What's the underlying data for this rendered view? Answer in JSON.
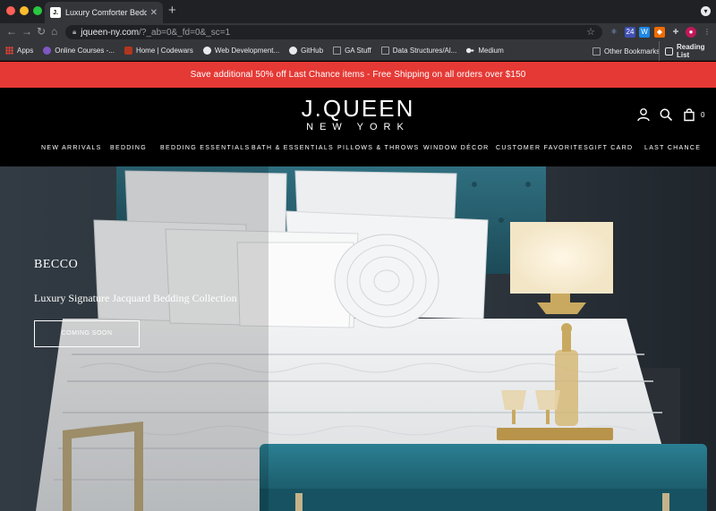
{
  "browser": {
    "tab_title": "Luxury Comforter Bedding Sets",
    "tab_favicon": "J.",
    "new_tab": "+",
    "url_host": "jqueen-ny.com",
    "url_path": "/?_ab=0&_fd=0&_sc=1"
  },
  "bookmarks": {
    "items": [
      {
        "label": "Apps",
        "icon": "apps-grid-icon",
        "color": "#ea4335"
      },
      {
        "label": "Online Courses -...",
        "icon": "courses-icon",
        "color": "#7e57c2"
      },
      {
        "label": "Home | Codewars",
        "icon": "codewars-icon",
        "color": "#b1361e"
      },
      {
        "label": "Web Development...",
        "icon": "web-dev-icon",
        "color": "#e8eaed"
      },
      {
        "label": "GitHub",
        "icon": "github-icon",
        "color": "#e8eaed"
      },
      {
        "label": "GA Stuff",
        "icon": "folder-icon",
        "color": "#9aa0a6"
      },
      {
        "label": "Data Structures/Al...",
        "icon": "folder-icon",
        "color": "#9aa0a6"
      },
      {
        "label": "Medium",
        "icon": "medium-icon",
        "color": "#e8eaed"
      }
    ],
    "other_bookmarks": "Other Bookmarks",
    "reading_list": "Reading List"
  },
  "promo": {
    "text": "Save additional 50% off Last Chance items - Free Shipping on all orders over $150",
    "color": "#e53935"
  },
  "header": {
    "logo_main": "J.QUEEN",
    "logo_sub": "NEW YORK",
    "cart_count": "0",
    "icons": [
      "account-icon",
      "search-icon",
      "cart-icon"
    ]
  },
  "nav": {
    "items": [
      "NEW ARRIVALS",
      "BEDDING",
      "BEDDING ESSENTIALS",
      "BATH & ESSENTIALS",
      "PILLOWS & THROWS",
      "WINDOW DÉCOR",
      "CUSTOMER FAVORITES",
      "GIFT CARD",
      "LAST CHANCE"
    ]
  },
  "hero": {
    "title": "BECCO",
    "subtitle": "Luxury Signature Jacquard Bedding Collection",
    "button": "COMING SOON"
  }
}
